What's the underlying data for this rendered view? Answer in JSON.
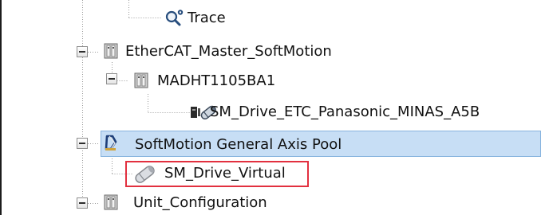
{
  "tree": {
    "nodes": [
      {
        "id": "trace",
        "label": "Trace",
        "icon": "trace-icon",
        "expanded": null,
        "selected": false,
        "highlighted": false
      },
      {
        "id": "ethercat-master",
        "label": "EtherCAT_Master_SoftMotion",
        "icon": "device-icon",
        "expanded": true,
        "selected": false,
        "highlighted": false
      },
      {
        "id": "madht",
        "label": "MADHT1105BA1",
        "icon": "device-icon",
        "expanded": true,
        "selected": false,
        "highlighted": false
      },
      {
        "id": "sm-drive-etc",
        "label": "SM_Drive_ETC_Panasonic_MINAS_A5B",
        "icon": "servo-axis-icon",
        "expanded": null,
        "selected": false,
        "highlighted": false
      },
      {
        "id": "axis-pool",
        "label": "SoftMotion General Axis Pool",
        "icon": "axis-pool-icon",
        "expanded": true,
        "selected": true,
        "highlighted": false
      },
      {
        "id": "sm-drive-virtual",
        "label": "SM_Drive_Virtual",
        "icon": "virtual-axis-icon",
        "expanded": null,
        "selected": false,
        "highlighted": true
      },
      {
        "id": "unit-config",
        "label": "Unit_Configuration",
        "icon": "device-icon",
        "expanded": true,
        "selected": false,
        "highlighted": false
      }
    ]
  },
  "colors": {
    "selection_background": "#c7def5",
    "selection_border": "#86b3de",
    "highlight_border": "#e2303f",
    "tree_line": "#9a9a9a"
  }
}
